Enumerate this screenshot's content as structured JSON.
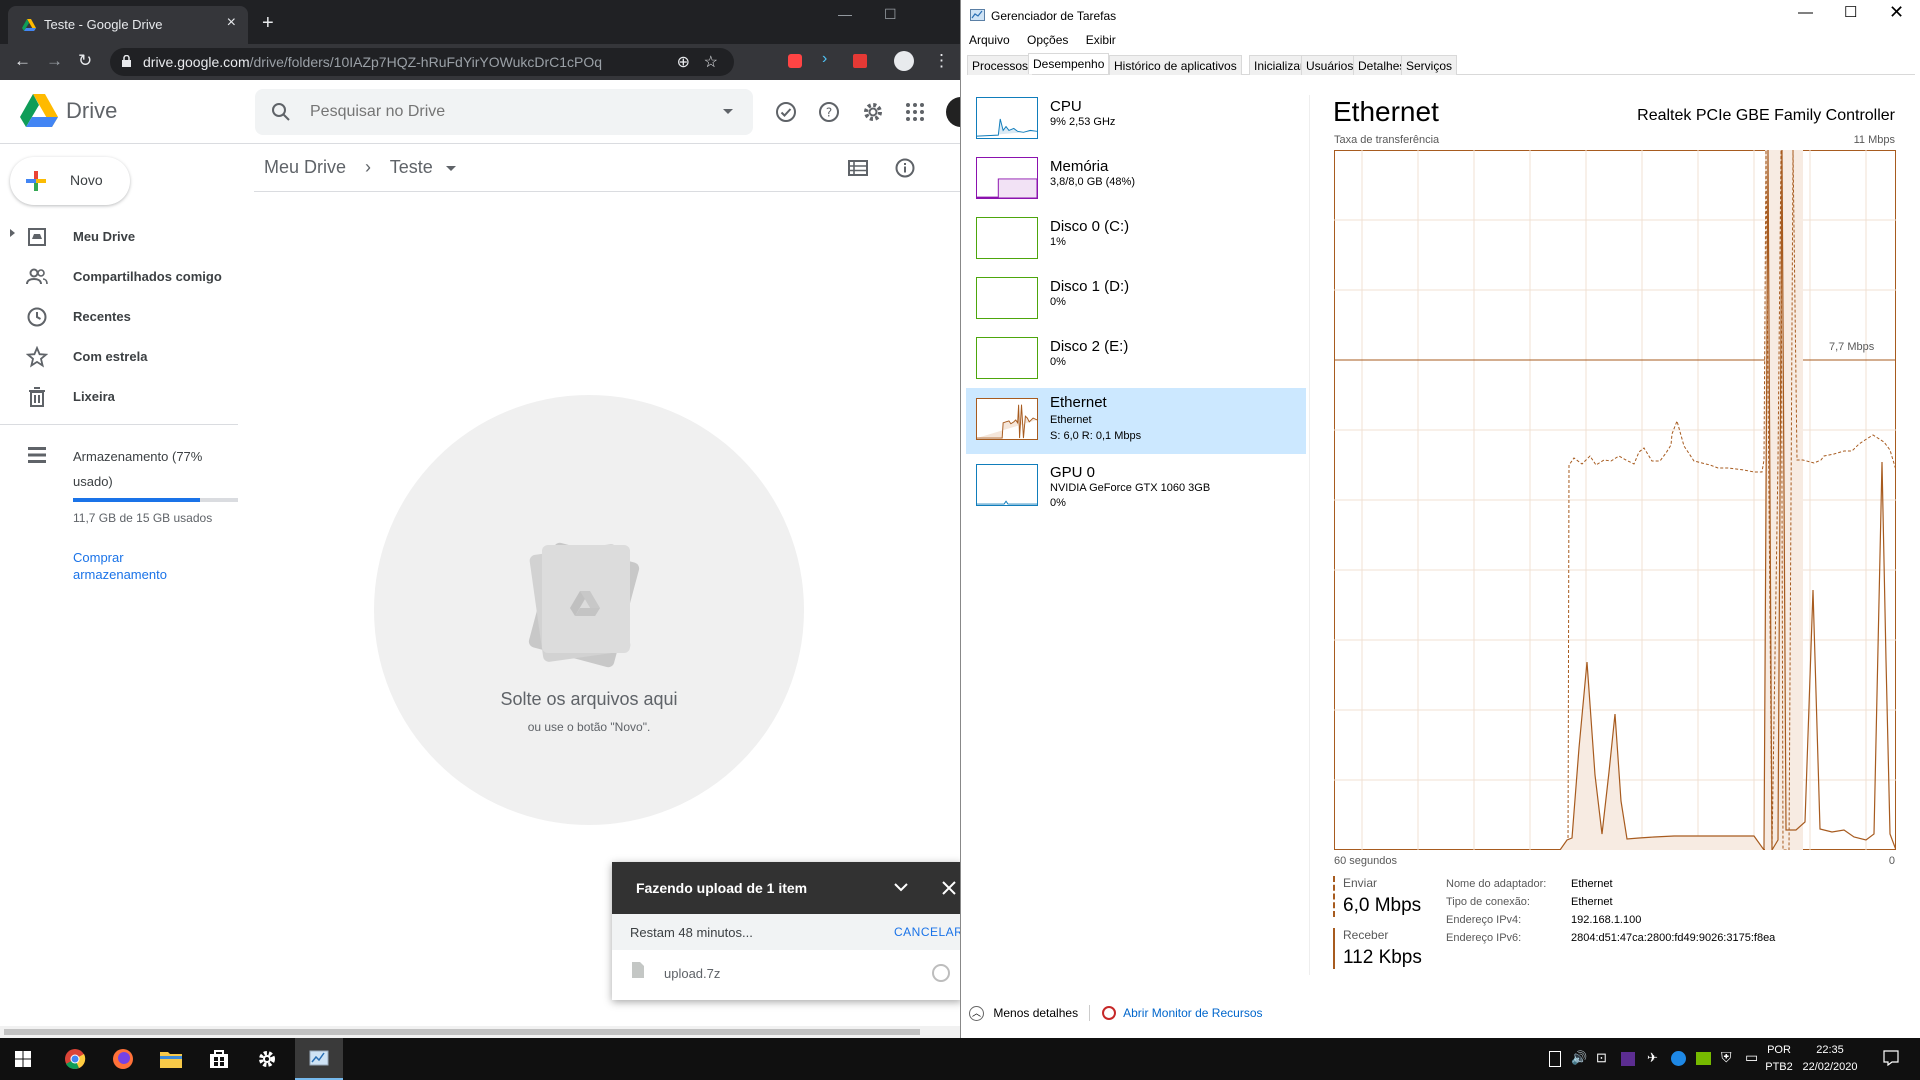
{
  "browser": {
    "tab_title": "Teste - Google Drive",
    "url_host": "drive.google.com",
    "url_path": "/drive/folders/10IAZp7HQZ-hRuFdYirYOWukcDrC1cPOq"
  },
  "drive": {
    "app_name": "Drive",
    "search_placeholder": "Pesquisar no Drive",
    "new_label": "Novo",
    "sidebar": {
      "items": [
        {
          "label": "Meu Drive"
        },
        {
          "label": "Compartilhados comigo"
        },
        {
          "label": "Recentes"
        },
        {
          "label": "Com estrela"
        },
        {
          "label": "Lixeira"
        }
      ],
      "storage_label": "Armazenamento (77% usado)",
      "storage_used": "11,7 GB de 15 GB usados",
      "storage_fraction": 0.77,
      "buy_label": "Comprar armazenamento"
    },
    "breadcrumb": {
      "root": "Meu Drive",
      "current": "Teste"
    },
    "drop": {
      "title": "Solte os arquivos aqui",
      "hint": "ou use o botão \"Novo\"."
    },
    "upload": {
      "title": "Fazendo upload de 1 item",
      "remaining": "Restam 48 minutos...",
      "cancel": "CANCELAR",
      "file": "upload.7z"
    }
  },
  "taskmgr": {
    "title": "Gerenciador de Tarefas",
    "menu": [
      "Arquivo",
      "Opções",
      "Exibir"
    ],
    "tabs": [
      "Processos",
      "Desempenho",
      "Histórico de aplicativos",
      "Inicializar",
      "Usuários",
      "Detalhes",
      "Serviços"
    ],
    "resources": [
      {
        "name": "CPU",
        "sub1": "9% 2,53 GHz",
        "sub2": ""
      },
      {
        "name": "Memória",
        "sub1": "3,8/8,0 GB (48%)",
        "sub2": ""
      },
      {
        "name": "Disco 0 (C:)",
        "sub1": "1%",
        "sub2": ""
      },
      {
        "name": "Disco 1 (D:)",
        "sub1": "0%",
        "sub2": ""
      },
      {
        "name": "Disco 2 (E:)",
        "sub1": "0%",
        "sub2": ""
      },
      {
        "name": "Ethernet",
        "sub1": "Ethernet",
        "sub2": "S: 6,0 R: 0,1 Mbps"
      },
      {
        "name": "GPU 0",
        "sub1": "NVIDIA GeForce GTX 1060 3GB",
        "sub2": "0%"
      }
    ],
    "detail": {
      "title": "Ethernet",
      "controller": "Realtek PCIe GBE Family Controller",
      "graph_label": "Taxa de transferência",
      "graph_max": "11 Mbps",
      "graph_mid": "7,7 Mbps",
      "graph_left": "60 segundos",
      "graph_right": "0",
      "send_label": "Enviar",
      "send_value": "6,0 Mbps",
      "recv_label": "Receber",
      "recv_value": "112 Kbps",
      "props": [
        {
          "k": "Nome do adaptador:",
          "v": "Ethernet"
        },
        {
          "k": "Tipo de conexão:",
          "v": "Ethernet"
        },
        {
          "k": "Endereço IPv4:",
          "v": "192.168.1.100"
        },
        {
          "k": "Endereço IPv6:",
          "v": "2804:d51:47ca:2800:fd49:9026:3175:f8ea"
        }
      ]
    },
    "footer": {
      "less": "Menos detalhes",
      "resmon": "Abrir Monitor de Recursos"
    }
  },
  "taskbar": {
    "lang1": "POR",
    "lang2": "PTB2",
    "time": "22:35",
    "date": "22/02/2020"
  },
  "colors": {
    "eth": "#a75b1f",
    "cpu": "#117dbb",
    "mem": "#8b12ae",
    "disk": "#4da60c",
    "accent": "#1a73e8"
  }
}
